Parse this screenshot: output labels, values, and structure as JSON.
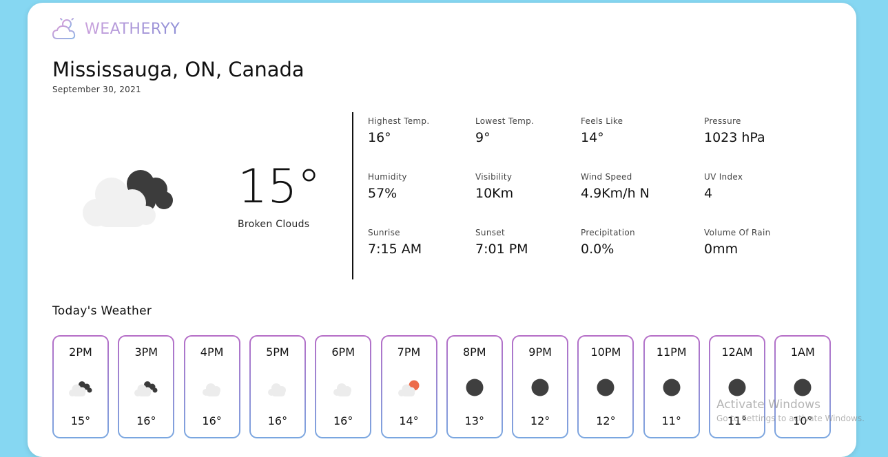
{
  "app": {
    "brand": "WEATHERYY"
  },
  "location": "Mississauga, ON, Canada",
  "date": "September 30, 2021",
  "current": {
    "temp": "15°",
    "condition": "Broken Clouds",
    "icon": "broken-clouds-icon"
  },
  "stats": [
    {
      "label": "Highest Temp.",
      "value": "16°"
    },
    {
      "label": "Lowest Temp.",
      "value": "9°"
    },
    {
      "label": "Feels Like",
      "value": "14°"
    },
    {
      "label": "Pressure",
      "value": "1023 hPa"
    },
    {
      "label": "Humidity",
      "value": "57%"
    },
    {
      "label": "Visibility",
      "value": "10Km"
    },
    {
      "label": "Wind Speed",
      "value": "4.9Km/h N"
    },
    {
      "label": "UV Index",
      "value": "4"
    },
    {
      "label": "Sunrise",
      "value": "7:15 AM"
    },
    {
      "label": "Sunset",
      "value": "7:01 PM"
    },
    {
      "label": "Precipitation",
      "value": "0.0%"
    },
    {
      "label": "Volume Of Rain",
      "value": "0mm"
    }
  ],
  "today": {
    "title": "Today's Weather",
    "hours": [
      {
        "time": "2PM",
        "temp": "15°",
        "icon": "broken-clouds-icon"
      },
      {
        "time": "3PM",
        "temp": "16°",
        "icon": "broken-clouds-icon"
      },
      {
        "time": "4PM",
        "temp": "16°",
        "icon": "cloud-icon"
      },
      {
        "time": "5PM",
        "temp": "16°",
        "icon": "cloud-icon"
      },
      {
        "time": "6PM",
        "temp": "16°",
        "icon": "cloud-icon"
      },
      {
        "time": "7PM",
        "temp": "14°",
        "icon": "sunset-cloud-icon"
      },
      {
        "time": "8PM",
        "temp": "13°",
        "icon": "night-icon"
      },
      {
        "time": "9PM",
        "temp": "12°",
        "icon": "night-icon"
      },
      {
        "time": "10PM",
        "temp": "12°",
        "icon": "night-icon"
      },
      {
        "time": "11PM",
        "temp": "11°",
        "icon": "night-icon"
      },
      {
        "time": "12AM",
        "temp": "11°",
        "icon": "night-icon"
      },
      {
        "time": "1AM",
        "temp": "10°",
        "icon": "night-icon"
      }
    ]
  },
  "watermark": {
    "title": "Activate Windows",
    "subtitle": "Go to Settings to activate Windows."
  },
  "colors": {
    "background": "#86d7f2",
    "brand_start": "#c9a0dc",
    "brand_end": "#8f8fd6",
    "card_border_top": "#b66dc7",
    "card_border_bottom": "#7aa7e0"
  }
}
